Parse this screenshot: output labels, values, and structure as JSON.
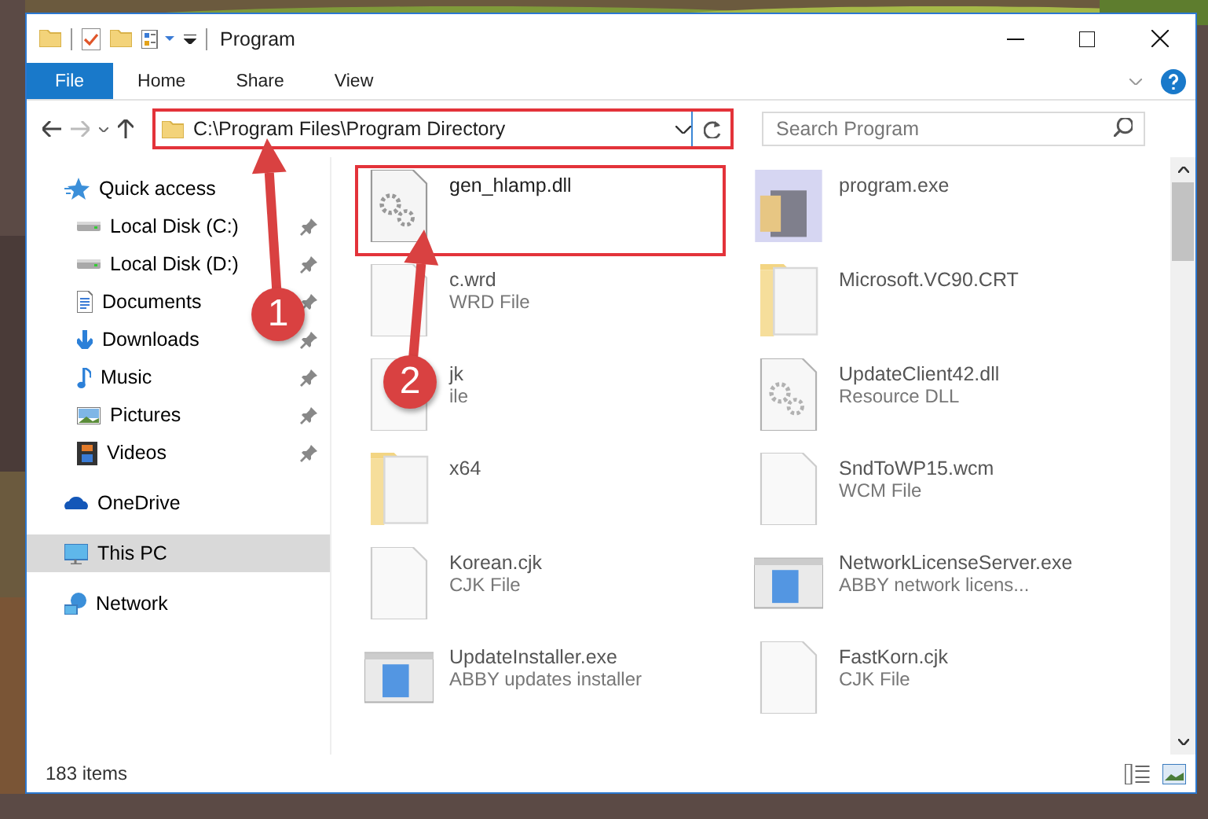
{
  "window": {
    "title": "Program"
  },
  "ribbon_tabs": [
    {
      "label": "File",
      "selected": true
    },
    {
      "label": "Home",
      "selected": false
    },
    {
      "label": "Share",
      "selected": false
    },
    {
      "label": "View",
      "selected": false
    }
  ],
  "address_bar": {
    "path": "C:\\Program Files\\Program Directory",
    "highlighted": true
  },
  "search": {
    "placeholder": "Search Program"
  },
  "sidebar": {
    "items": [
      {
        "label": "Quick access",
        "selected": false,
        "children": [
          {
            "label": "Local Disk (C:)",
            "pinned": true,
            "selected": false
          },
          {
            "label": "Local Disk (D:)",
            "pinned": true,
            "selected": false
          },
          {
            "label": "Documents",
            "pinned": true,
            "selected": false
          },
          {
            "label": "Downloads",
            "pinned": true,
            "selected": false
          },
          {
            "label": "Music",
            "pinned": true,
            "selected": false
          },
          {
            "label": "Pictures",
            "pinned": true,
            "selected": false
          },
          {
            "label": "Videos",
            "pinned": true,
            "selected": false
          }
        ]
      },
      {
        "label": "OneDrive",
        "selected": false
      },
      {
        "label": "This PC",
        "selected": true
      },
      {
        "label": "Network",
        "selected": false
      }
    ]
  },
  "files": [
    {
      "name": "gen_hlamp.dll",
      "kind": "gears",
      "highlighted": true
    },
    {
      "name": "program.exe",
      "kind": "app",
      "highlighted": false
    },
    {
      "name": "c.wrd",
      "type": "WRD File",
      "kind": "blank",
      "highlighted": false
    },
    {
      "name": "Microsoft.VC90.CRT",
      "kind": "folder",
      "highlighted": false
    },
    {
      "name": "jk",
      "type": "ile",
      "kind": "blank",
      "highlighted": false
    },
    {
      "name": "UpdateClient42.dll",
      "type": "Resource DLL",
      "kind": "gears",
      "highlighted": false
    },
    {
      "name": "x64",
      "kind": "folder",
      "highlighted": false
    },
    {
      "name": "SndToWP15.wcm",
      "type": "WCM File",
      "kind": "blank",
      "highlighted": false
    },
    {
      "name": "Korean.cjk",
      "type": "CJK File",
      "kind": "blank",
      "highlighted": false
    },
    {
      "name": "NetworkLicenseServer.exe",
      "type": "ABBY network licens...",
      "kind": "window",
      "highlighted": false
    },
    {
      "name": "UpdateInstaller.exe",
      "type": "ABBY updates installer",
      "kind": "window",
      "highlighted": false
    },
    {
      "name": "FastKorn.cjk",
      "type": "CJK File",
      "kind": "blank",
      "highlighted": false
    }
  ],
  "annotations": [
    {
      "label": "1"
    },
    {
      "label": "2"
    }
  ],
  "status_bar": {
    "item_count": "183 items"
  }
}
